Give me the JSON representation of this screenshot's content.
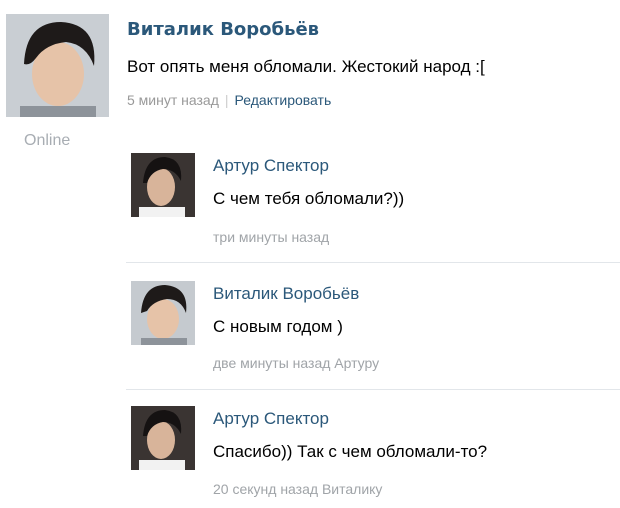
{
  "post": {
    "author": "Виталик Воробьёв",
    "text": "Вот опять меня обломали. Жестокий народ :[",
    "time": "5 минут назад",
    "separator": "|",
    "edit_label": "Редактировать",
    "online_label": "Online"
  },
  "comments": [
    {
      "author": "Артур Спектор",
      "text": "С чем тебя обломали?))",
      "meta": "три минуты назад"
    },
    {
      "author": "Виталик Воробьёв",
      "text": "С новым годом )",
      "meta": "две минуты назад Артуру"
    },
    {
      "author": "Артур Спектор",
      "text": "Спасибо)) Так с чем обломали-то?",
      "meta": "20 секунд назад Виталику"
    }
  ],
  "colors": {
    "link": "#2b587a",
    "meta": "#999999",
    "divider": "#e2e6ea"
  }
}
